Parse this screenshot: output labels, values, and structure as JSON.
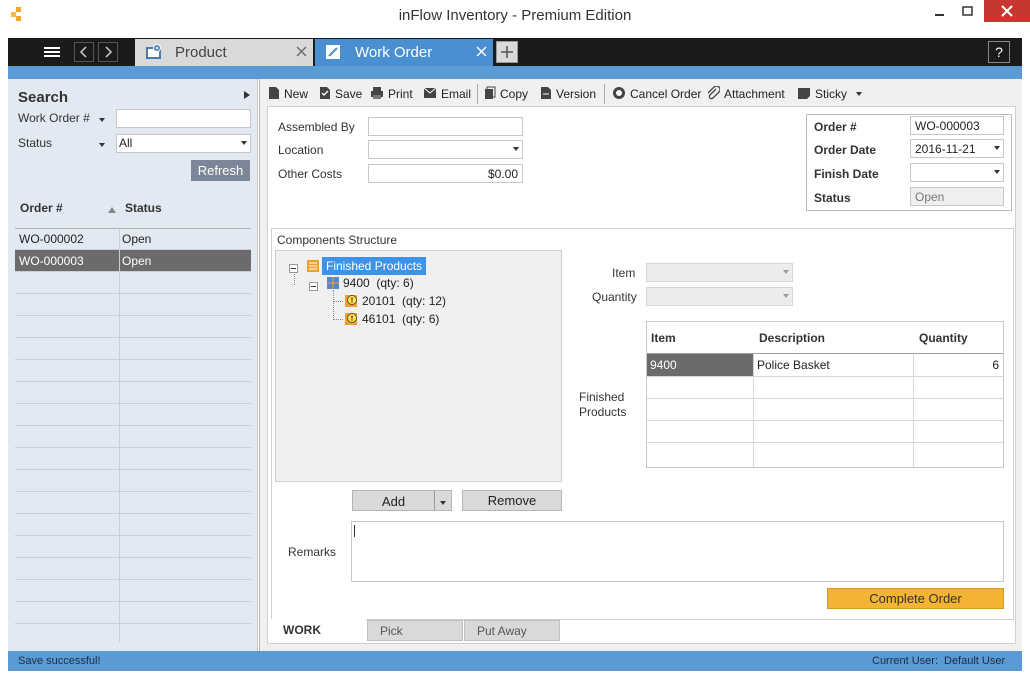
{
  "window": {
    "title": "inFlow Inventory - Premium Edition"
  },
  "tabs": [
    {
      "label": "Product"
    },
    {
      "label": "Work Order"
    }
  ],
  "help_label": "?",
  "search": {
    "title": "Search",
    "work_order_label": "Work Order #",
    "work_order_value": "",
    "status_label": "Status",
    "status_value": "All",
    "refresh_label": "Refresh"
  },
  "list": {
    "col_order": "Order #",
    "col_status": "Status",
    "rows": [
      {
        "order": "WO-000002",
        "status": "Open"
      },
      {
        "order": "WO-000003",
        "status": "Open"
      }
    ]
  },
  "toolbar": {
    "new": "New",
    "save": "Save",
    "print": "Print",
    "email": "Email",
    "copy": "Copy",
    "version": "Version",
    "cancel_order": "Cancel Order",
    "attachment": "Attachment",
    "sticky": "Sticky"
  },
  "form": {
    "assembled_by_label": "Assembled By",
    "assembled_by_value": "",
    "location_label": "Location",
    "location_value": "",
    "other_costs_label": "Other Costs",
    "other_costs_value": "$0.00"
  },
  "order_box": {
    "order_label": "Order #",
    "order_value": "WO-000003",
    "order_date_label": "Order Date",
    "order_date_value": "2016-11-21",
    "finish_date_label": "Finish Date",
    "finish_date_value": "",
    "status_label": "Status",
    "status_value": "Open"
  },
  "components": {
    "title": "Components Structure",
    "tree_root": "Finished Products",
    "tree_child": "9400  (qty: 6)",
    "tree_leaf1": "20101  (qty: 12)",
    "tree_leaf2": "46101  (qty: 6)",
    "item_label": "Item",
    "quantity_label": "Quantity",
    "finished_products_label": "Finished Products",
    "table_headers": {
      "item": "Item",
      "description": "Description",
      "quantity": "Quantity"
    },
    "table_rows": [
      {
        "item": "9400",
        "description": "Police Basket",
        "quantity": "6"
      }
    ],
    "add_label": "Add",
    "remove_label": "Remove"
  },
  "remarks": {
    "label": "Remarks",
    "value": ""
  },
  "complete_order_label": "Complete Order",
  "bottom_tabs": {
    "work": "WORK",
    "pick": "Pick",
    "put_away": "Put Away"
  },
  "status_bar": {
    "message": "Save successful!",
    "current_user_label": "Current User:",
    "current_user_value": "Default User"
  },
  "colors": {
    "accent_blue": "#5b9bd5",
    "tab_active": "#4a8fd0",
    "selected_row": "#6b6b6b",
    "complete_btn": "#f3b333"
  }
}
